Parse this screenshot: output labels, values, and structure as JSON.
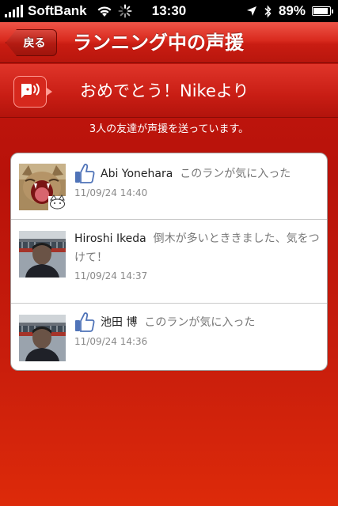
{
  "status_bar": {
    "carrier": "SoftBank",
    "time": "13:30",
    "battery_percent": "89%",
    "battery_level": 0.89,
    "icons": [
      "signal-icon",
      "wifi-icon",
      "activity-spinner-icon",
      "location-arrow-icon",
      "bluetooth-icon",
      "battery-icon"
    ]
  },
  "nav": {
    "back_label": "戻る",
    "title": "ランニング中の声援"
  },
  "cheer_header": {
    "icon": "voice-cheer-icon",
    "text": "おめでとう！Nikeより"
  },
  "friends_count_text": "3人の友達が声援を送っています。",
  "cheers": [
    {
      "has_like_icon": true,
      "name": "Abi Yonehara",
      "message": "このランが気に入った",
      "timestamp": "11/09/24  14:40",
      "avatar": "cat-avatar"
    },
    {
      "has_like_icon": false,
      "name": "Hiroshi Ikeda",
      "message": "倒木が多いとききました、気をつけて！",
      "timestamp": "11/09/24  14:37",
      "avatar": "runner-avatar"
    },
    {
      "has_like_icon": true,
      "name": "池田 博",
      "message": "このランが気に入った",
      "timestamp": "11/09/24  14:36",
      "avatar": "runner-avatar"
    }
  ],
  "colors": {
    "nav_red": "#d92a1e",
    "background_red": "#c4180f",
    "like_blue": "#4f73b8"
  }
}
